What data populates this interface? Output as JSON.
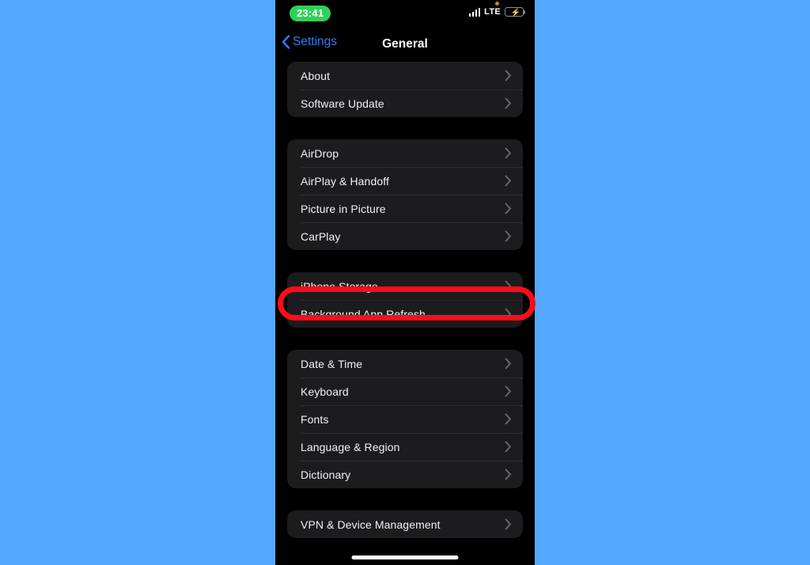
{
  "background": {
    "color": "#55a8ff"
  },
  "phone": {
    "screen_bg": "#000000",
    "status_bar": {
      "time": "23:41",
      "time_pill_color": "#30d158",
      "recording_indicator": true,
      "mic_dot_icon": "orange-dot-icon",
      "signal_icon": "cellular-bars-icon",
      "network": "LTE",
      "battery_icon": "battery-charging-icon",
      "battery_color": "#30d158",
      "charging_bolt": "⚡"
    },
    "nav_bar": {
      "back_icon": "chevron-left-icon",
      "back_label": "Settings",
      "title": "General",
      "accent_color": "#2f7cf6"
    },
    "groups": [
      {
        "name": "group-about",
        "rows": [
          {
            "label": "About",
            "accessory": "chevron-right-icon"
          },
          {
            "label": "Software Update",
            "accessory": "chevron-right-icon"
          }
        ]
      },
      {
        "name": "group-connectivity",
        "rows": [
          {
            "label": "AirDrop",
            "accessory": "chevron-right-icon"
          },
          {
            "label": "AirPlay & Handoff",
            "accessory": "chevron-right-icon"
          },
          {
            "label": "Picture in Picture",
            "accessory": "chevron-right-icon"
          },
          {
            "label": "CarPlay",
            "accessory": "chevron-right-icon"
          }
        ]
      },
      {
        "name": "group-storage",
        "rows": [
          {
            "label": "iPhone Storage",
            "accessory": "chevron-right-icon",
            "highlighted": true
          },
          {
            "label": "Background App Refresh",
            "accessory": "chevron-right-icon"
          }
        ]
      },
      {
        "name": "group-localization",
        "rows": [
          {
            "label": "Date & Time",
            "accessory": "chevron-right-icon"
          },
          {
            "label": "Keyboard",
            "accessory": "chevron-right-icon"
          },
          {
            "label": "Fonts",
            "accessory": "chevron-right-icon"
          },
          {
            "label": "Language & Region",
            "accessory": "chevron-right-icon"
          },
          {
            "label": "Dictionary",
            "accessory": "chevron-right-icon"
          }
        ]
      },
      {
        "name": "group-management",
        "rows": [
          {
            "label": "VPN & Device Management",
            "accessory": "chevron-right-icon"
          }
        ]
      }
    ],
    "home_indicator": true
  },
  "annotation": {
    "type": "rounded-rectangle-highlight",
    "color": "#fc0d1b",
    "target": "iPhone Storage"
  }
}
